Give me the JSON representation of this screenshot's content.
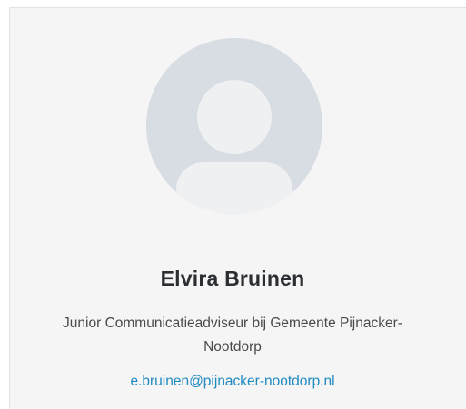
{
  "profile": {
    "name": "Elvira Bruinen",
    "role": "Junior Communicatieadviseur bij Gemeente Pijnacker-Nootdorp",
    "email": "e.bruinen@pijnacker-nootdorp.nl",
    "avatar_icon": "default-user-avatar-icon"
  },
  "colors": {
    "card_background": "#f5f5f5",
    "avatar_background": "#d8dde3",
    "avatar_figure": "#eef0f2",
    "name_text": "#2b2e33",
    "email_link": "#1f8ac0"
  }
}
